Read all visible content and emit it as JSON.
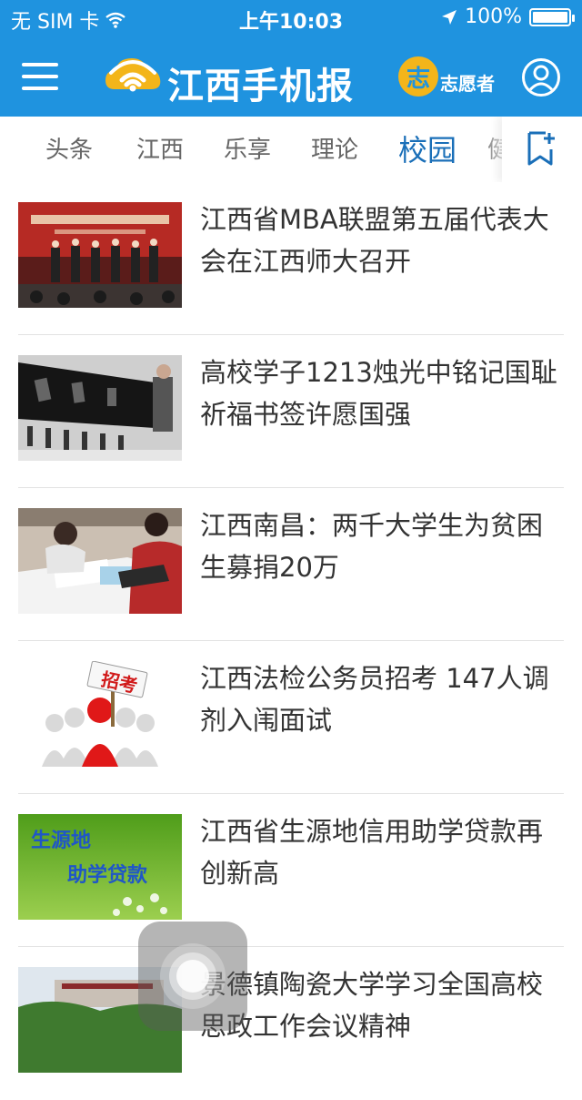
{
  "status_bar": {
    "carrier": "无 SIM 卡",
    "time": "上午10:03",
    "battery": "100%"
  },
  "header": {
    "logo_text": "江西手机报",
    "volunteer_badge": "志",
    "volunteer_label": "志愿者"
  },
  "tabs": [
    {
      "label": "头条"
    },
    {
      "label": "江西"
    },
    {
      "label": "乐享"
    },
    {
      "label": "理论"
    },
    {
      "label": "校园"
    },
    {
      "label": "健"
    }
  ],
  "articles": [
    {
      "title": "江西省MBA联盟第五届代表大会在江西师大召开"
    },
    {
      "title": "高校学子1213烛光中铭记国耻 祈福书签许愿国强"
    },
    {
      "title": "江西南昌：两千大学生为贫困生募捐20万"
    },
    {
      "title": "江西法检公务员招考 147人调剂入闱面试"
    },
    {
      "title": "江西省生源地信用助学贷款再创新高"
    },
    {
      "title": "景德镇陶瓷大学学习全国高校思政工作会议精神"
    }
  ],
  "thumb_text": {
    "t4_sign": "招考",
    "t5_line1": "生源地",
    "t5_line2": "助学贷款"
  },
  "colors": {
    "brand_blue": "#1f93df",
    "active_tab": "#1a6fb8",
    "badge_yellow": "#f3b51a"
  }
}
